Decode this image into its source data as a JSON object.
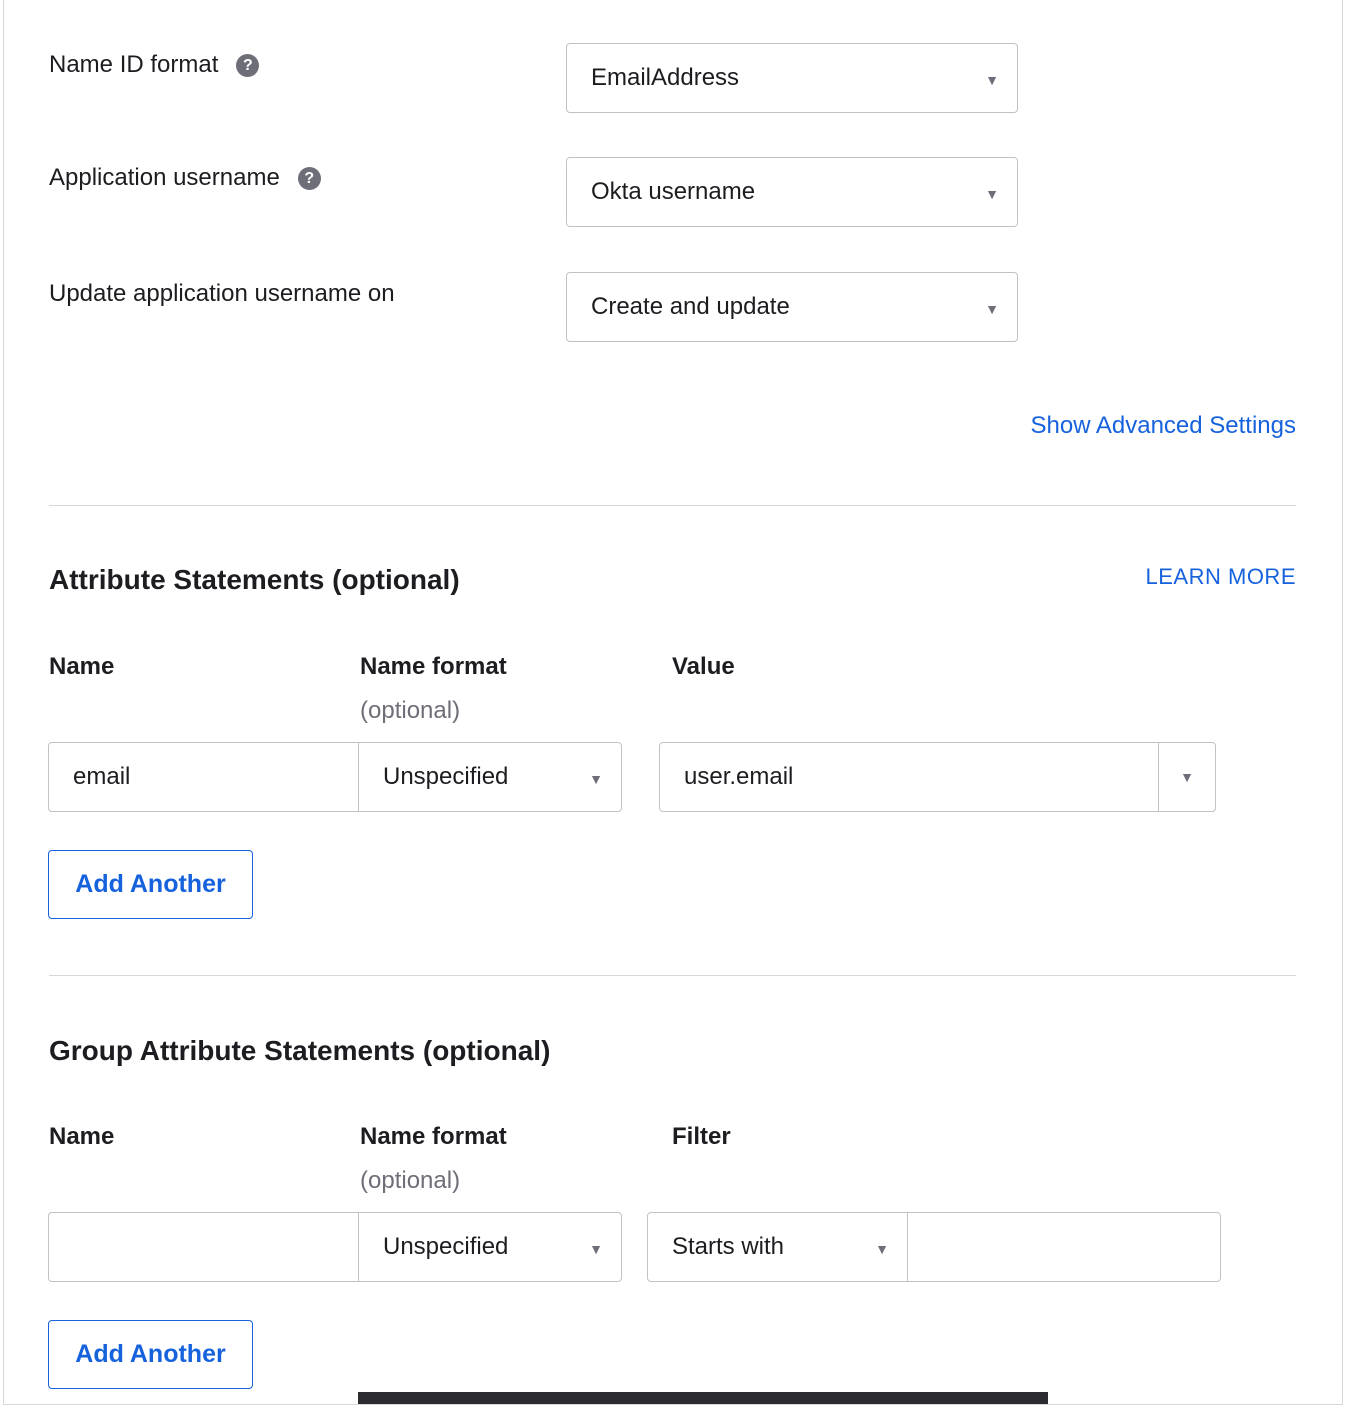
{
  "general": {
    "name_id_format": {
      "label": "Name ID format",
      "value": "EmailAddress"
    },
    "application_username": {
      "label": "Application username",
      "value": "Okta username"
    },
    "update_username_on": {
      "label": "Update application username on",
      "value": "Create and update"
    },
    "show_advanced": "Show Advanced Settings",
    "help_glyph": "?"
  },
  "attribute_statements": {
    "title": "Attribute Statements (optional)",
    "learn_more": "LEARN MORE",
    "headers": {
      "name": "Name",
      "name_format": "Name format",
      "optional": "(optional)",
      "value": "Value"
    },
    "row": {
      "name": "email",
      "name_format": "Unspecified",
      "value": "user.email"
    },
    "add_button": "Add Another"
  },
  "group_attribute_statements": {
    "title": "Group Attribute Statements (optional)",
    "headers": {
      "name": "Name",
      "name_format": "Name format",
      "optional": "(optional)",
      "filter": "Filter"
    },
    "row": {
      "name": "",
      "name_format": "Unspecified",
      "filter_type": "Starts with",
      "filter_value": ""
    },
    "add_button": "Add Another"
  },
  "icons": {
    "caret": "chevron-down-icon",
    "help": "help-icon"
  },
  "colors": {
    "link": "#1662dd",
    "border": "#c1c1c8",
    "text": "#1d1d21",
    "muted": "#6e6e78"
  }
}
